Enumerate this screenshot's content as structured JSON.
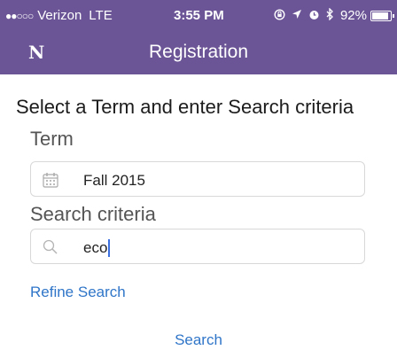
{
  "status_bar": {
    "signal_dots": "●●○○○",
    "carrier": "Verizon",
    "network": "LTE",
    "time": "3:55 PM",
    "battery": "92%",
    "battery_level": 0.92,
    "icons": [
      "orientation-lock-icon",
      "location-arrow-icon",
      "alarm-icon",
      "bluetooth-icon",
      "battery-icon"
    ]
  },
  "nav": {
    "logo": "N",
    "title": "Registration"
  },
  "form": {
    "heading": "Select a Term and enter Search criteria",
    "term_label": "Term",
    "term_value": "Fall 2015",
    "criteria_label": "Search criteria",
    "criteria_value": "eco",
    "refine_link": "Refine Search",
    "search_button": "Search"
  },
  "colors": {
    "header": "#6b5596",
    "link": "#2f75c8"
  }
}
